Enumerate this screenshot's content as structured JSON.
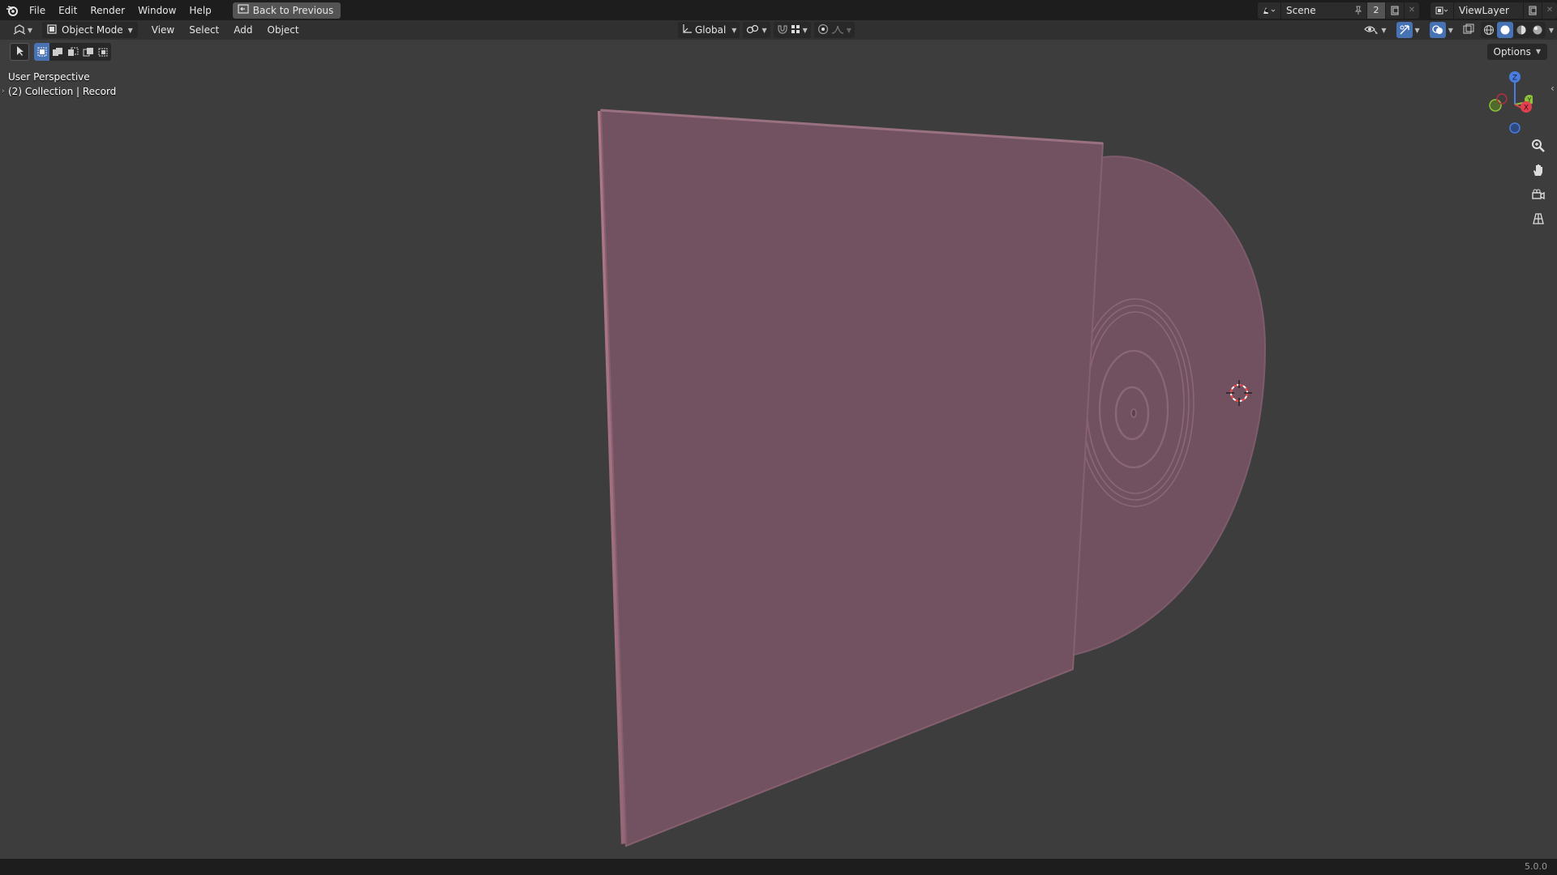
{
  "topbar": {
    "menus": [
      "File",
      "Edit",
      "Render",
      "Window",
      "Help"
    ],
    "back_button": "Back to Previous",
    "scene_name": "Scene",
    "scene_users": "2",
    "view_layer": "ViewLayer"
  },
  "header": {
    "mode": "Object Mode",
    "menus": [
      "View",
      "Select",
      "Add",
      "Object"
    ],
    "transform_orientation": "Global"
  },
  "toolbar": {
    "options_label": "Options"
  },
  "viewport": {
    "perspective_label": "User Perspective",
    "collection_label": "(2) Collection | Record",
    "object_color": "#725260",
    "background_color": "#3d3d3d",
    "gizmo_axes": [
      "Z",
      "Y",
      "X"
    ]
  },
  "status": {
    "version": "5.0.0"
  }
}
